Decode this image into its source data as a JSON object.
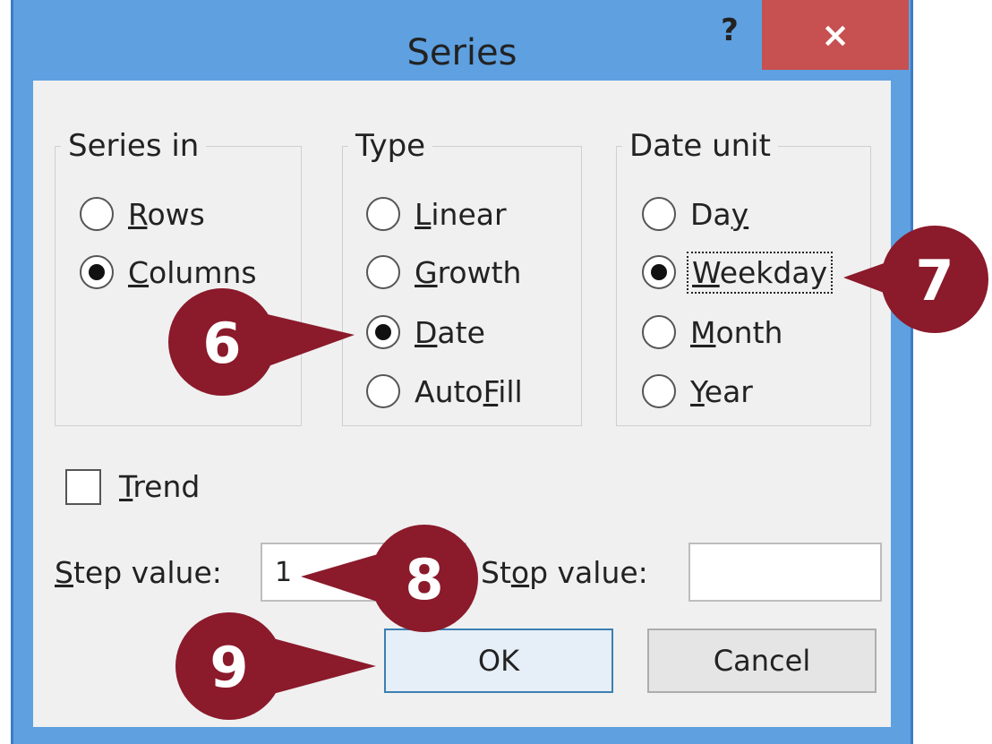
{
  "dialog": {
    "title": "Series",
    "help_label": "?",
    "close_label": "×"
  },
  "series_in": {
    "legend": "Series in",
    "options": [
      {
        "label": "Rows",
        "accel": "R",
        "rest": "ows",
        "selected": false
      },
      {
        "label": "Columns",
        "accel": "C",
        "rest": "olumns",
        "selected": true
      }
    ]
  },
  "type": {
    "legend": "Type",
    "options": [
      {
        "label": "Linear",
        "accel": "L",
        "rest": "inear",
        "selected": false
      },
      {
        "label": "Growth",
        "accel": "G",
        "rest": "rowth",
        "selected": false
      },
      {
        "label": "Date",
        "accel": "D",
        "rest": "ate",
        "selected": true
      },
      {
        "label": "AutoFill",
        "pre": "Auto",
        "accel": "F",
        "rest": "ill",
        "selected": false
      }
    ]
  },
  "date_unit": {
    "legend": "Date unit",
    "options": [
      {
        "label": "Day",
        "pre": "Da",
        "accel": "y",
        "rest": "",
        "selected": false
      },
      {
        "label": "Weekday",
        "accel": "W",
        "rest": "eekday",
        "selected": true,
        "focused": true
      },
      {
        "label": "Month",
        "accel": "M",
        "rest": "onth",
        "selected": false
      },
      {
        "label": "Year",
        "accel": "Y",
        "rest": "ear",
        "selected": false
      }
    ]
  },
  "trend": {
    "accel": "T",
    "rest": "rend",
    "checked": false
  },
  "step_value": {
    "accel": "S",
    "rest": "tep value:",
    "value": "1"
  },
  "stop_value": {
    "pre": "St",
    "accel": "o",
    "rest": "p value:",
    "value": ""
  },
  "buttons": {
    "ok": "OK",
    "cancel": "Cancel"
  },
  "callouts": [
    "6",
    "7",
    "8",
    "9"
  ],
  "colors": {
    "callout": "#8b1a2b",
    "title_bar": "#5ea0e0",
    "close": "#c75050"
  }
}
